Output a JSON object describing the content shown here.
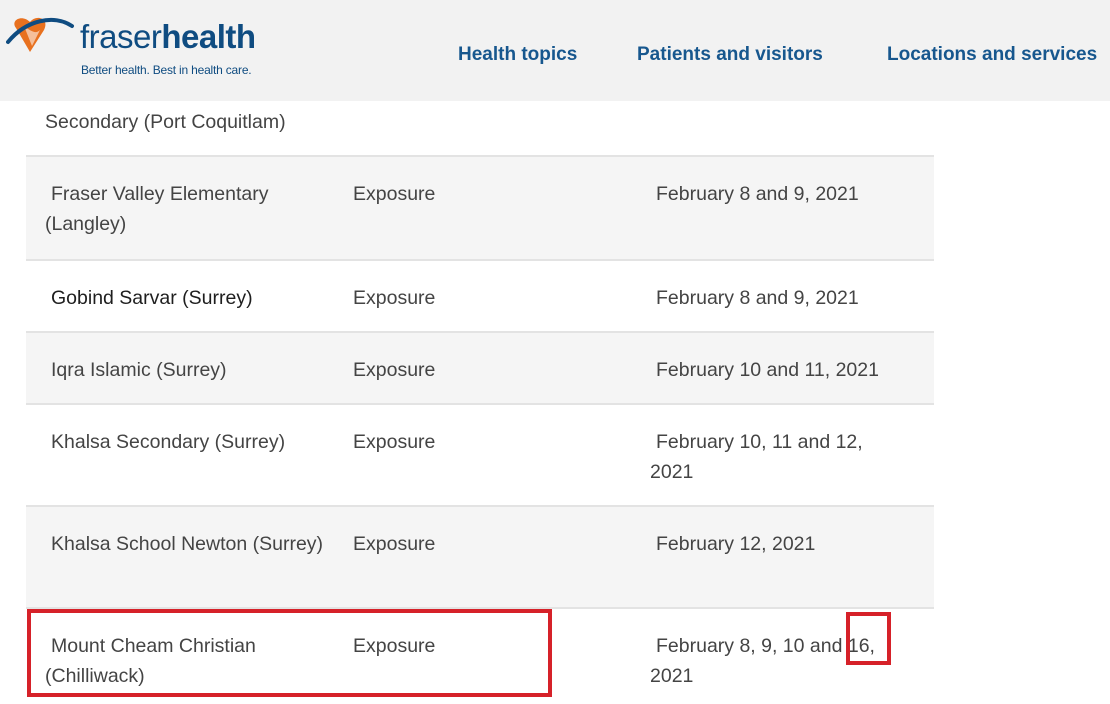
{
  "header": {
    "brand_light": "fraser",
    "brand_bold": "health",
    "tagline": "Better health. Best in health care.",
    "nav": [
      {
        "label": "Health topics"
      },
      {
        "label": "Patients and visitors"
      },
      {
        "label": "Locations and services"
      }
    ]
  },
  "colors": {
    "brand_blue": "#0f4c81",
    "nav_blue": "#17578e",
    "logo_orange": "#e8711f",
    "highlight_red": "#d62129",
    "row_shade": "#f5f5f5"
  },
  "table": {
    "partial_top_text": "Secondary (Port Coquitlam)",
    "rows": [
      {
        "school": "Fraser Valley Elementary (Langley)",
        "type": "Exposure",
        "dates": "February 8 and 9, 2021"
      },
      {
        "school": "Gobind Sarvar (Surrey)",
        "type": "Exposure",
        "dates": "February 8 and 9, 2021"
      },
      {
        "school": "Iqra Islamic (Surrey)",
        "type": "Exposure",
        "dates": "February 10 and 11, 2021"
      },
      {
        "school": "Khalsa Secondary (Surrey)",
        "type": "Exposure",
        "dates": "February 10, 11 and 12, 2021"
      },
      {
        "school": "Khalsa School Newton (Surrey)",
        "type": "Exposure",
        "dates": "February 12, 2021"
      },
      {
        "school": "Mount Cheam Christian (Chilliwack)",
        "type": "Exposure",
        "dates": "February 8, 9, 10 and 16, 2021"
      }
    ]
  }
}
